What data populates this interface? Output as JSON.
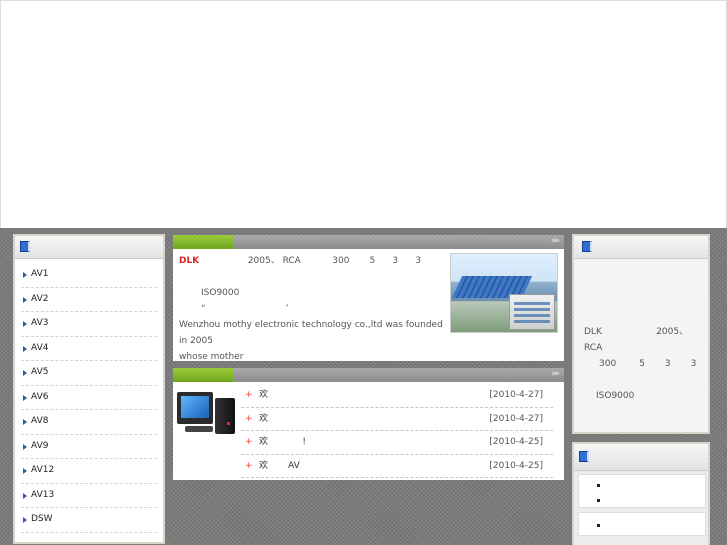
{
  "colors": {
    "accent_green": "#7fb52a",
    "brand_red": "#d22222",
    "nav_arrow": "#2b5aa8"
  },
  "left_nav": {
    "items": [
      "AV1",
      "AV2",
      "AV3",
      "AV4",
      "AV5",
      "AV6",
      "AV8",
      "AV9",
      "AV12",
      "AV13",
      "DSW"
    ]
  },
  "about": {
    "brand": "DLK",
    "line1_rest": "2005、 RCA           300       5      3      3",
    "line2": "ISO9000",
    "line3": "“                            ’",
    "english_line1": "Wenzhou mothy electronic technology co.,ltd was founded in 2005",
    "english_line2": "whose mother",
    "more_glyph": "»»"
  },
  "news": {
    "items": [
      {
        "title": "欢",
        "date": "[2010-4-27]"
      },
      {
        "title": "欢",
        "date": "[2010-4-27]"
      },
      {
        "title": "欢            !",
        "date": "[2010-4-25]"
      },
      {
        "title": "欢       AV",
        "date": "[2010-4-25]"
      }
    ]
  },
  "right": {
    "line1": "DLK                   2005、 RCA",
    "line2": "300        5       3       3",
    "line3": "ISO9000"
  }
}
